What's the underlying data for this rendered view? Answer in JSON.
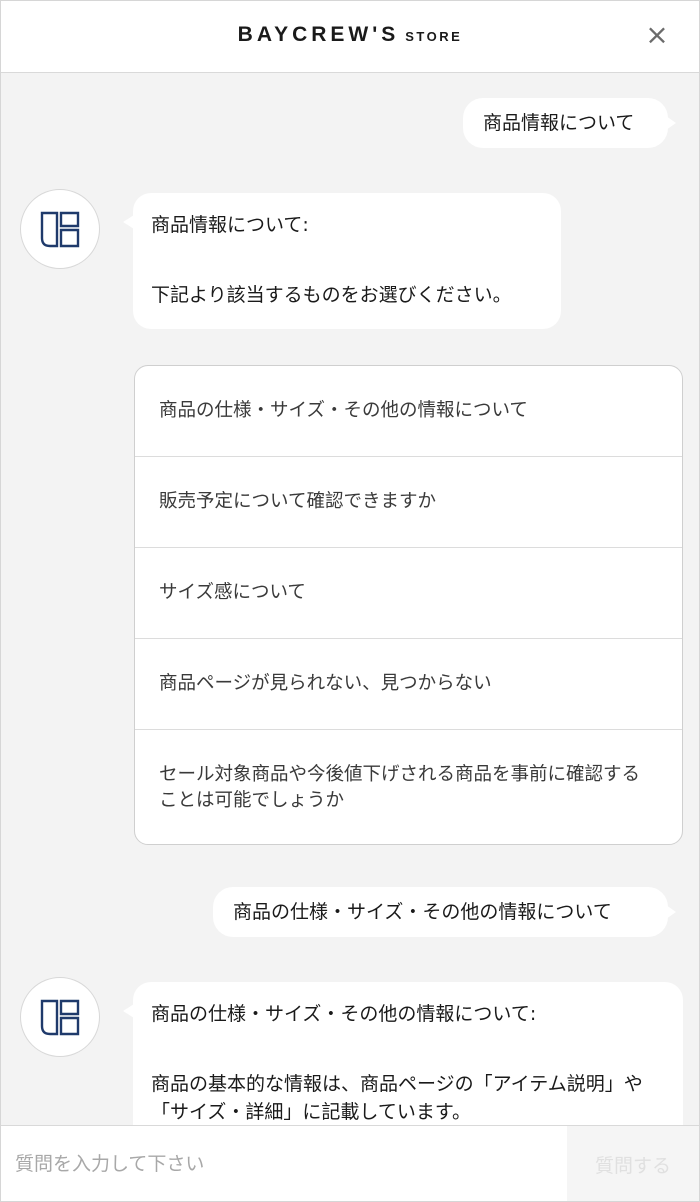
{
  "header": {
    "brand_main": "BAYCREW'S",
    "brand_sub": "STORE",
    "close_icon": "×"
  },
  "messages": {
    "user_1": "商品情報について",
    "bot_1": {
      "line_1": "商品情報について:",
      "line_2": "下記より該当するものをお選びください。"
    },
    "options": [
      "商品の仕様・サイズ・その他の情報について",
      "販売予定について確認できますか",
      "サイズ感について",
      "商品ページが見られない、見つからない",
      "セール対象商品や今後値下げされる商品を事前に確認することは可能でしょうか"
    ],
    "user_2": "商品の仕様・サイズ・その他の情報について",
    "bot_2": {
      "line_1": "商品の仕様・サイズ・その他の情報について:",
      "line_2": "商品の基本的な情報は、商品ページの「アイテム説明」や「サイズ・詳細」に記載しています。"
    }
  },
  "input": {
    "placeholder": "質問を入力して下さい",
    "send_label": "質問する"
  },
  "icons": {
    "avatar": "store-logo-icon",
    "close": "close-icon"
  },
  "colors": {
    "background": "#f3f3f3",
    "bubble": "#ffffff",
    "logo": "#1f3a6b"
  }
}
